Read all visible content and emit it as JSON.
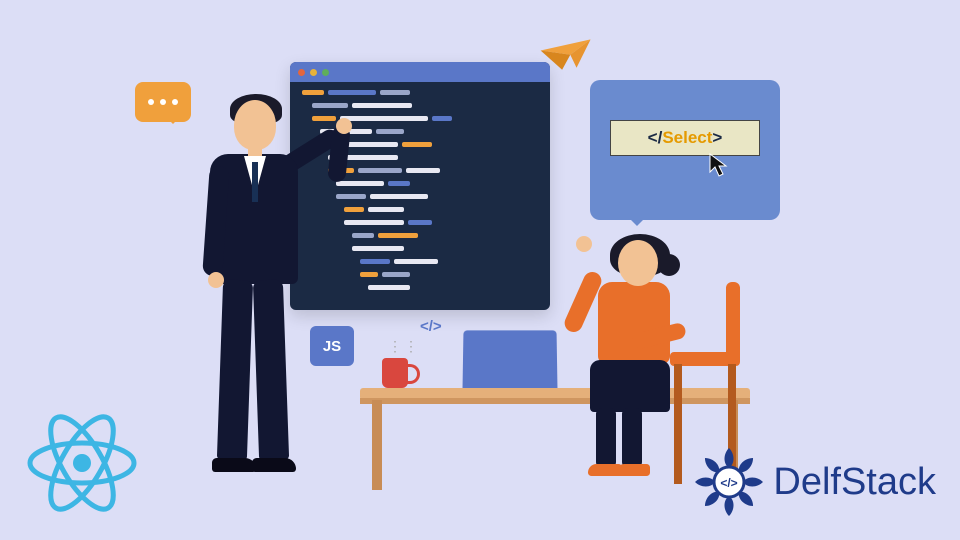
{
  "colors": {
    "bg": "#dcdef6",
    "editor_bg": "#1b2a44",
    "accent_blue": "#5a77c8",
    "accent_orange": "#e86f2a",
    "badge_orange": "#f0a03c",
    "navy": "#121732",
    "red": "#d9473e",
    "select_bg": "#e9e6c5",
    "react": "#3db6e4",
    "brand_blue": "#1f3b8a"
  },
  "editor": {
    "dots": [
      "#e4663e",
      "#e8b23a",
      "#5fae5a"
    ]
  },
  "chat_bubble": {
    "dots": 3
  },
  "select_tag": {
    "open": "<",
    "slash": "/",
    "keyword": "Select",
    "close": ">"
  },
  "js_badge": {
    "label": "JS"
  },
  "mini_tag": {
    "text": "</>"
  },
  "paper_plane": {
    "color": "#f0a03c"
  },
  "brand": {
    "name_strong": "Delf",
    "name_light": "Stack",
    "glyph": "</>"
  },
  "react_logo": {
    "label": "React"
  }
}
